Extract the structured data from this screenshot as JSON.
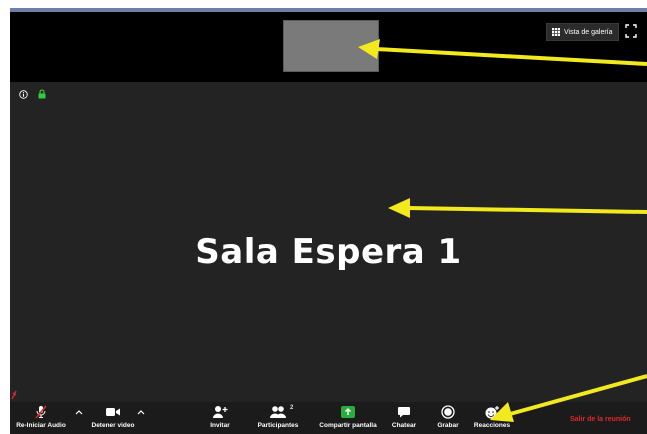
{
  "header": {
    "gallery_view_label": "Vista de galería"
  },
  "main": {
    "participant_name": "Sala Espera 1"
  },
  "toolbar": {
    "audio_label": "Re-Iniciar Audio",
    "video_label": "Detener video",
    "invite_label": "Invitar",
    "participants_label": "Participantes",
    "participants_count": "2",
    "share_label": "Compartir pantalla",
    "chat_label": "Chatear",
    "record_label": "Grabar",
    "reactions_label": "Reacciones",
    "leave_label": "Salir de la reunión"
  },
  "colors": {
    "share_green": "#27ae3e",
    "leave_red": "#e02828",
    "annotation_arrow": "#f2ea1e",
    "lock_green": "#2ecc40"
  }
}
